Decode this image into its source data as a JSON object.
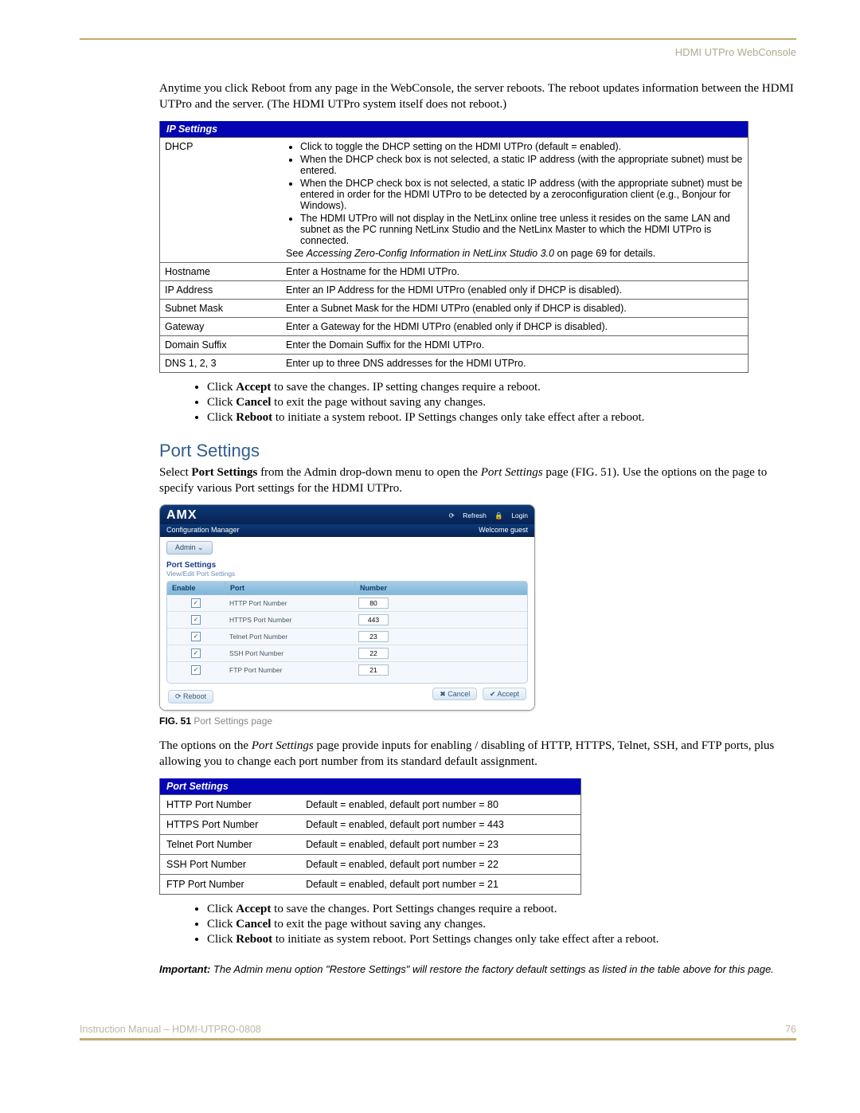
{
  "header": {
    "section_title": "HDMI UTPro WebConsole"
  },
  "intro": {
    "para": "Anytime you click Reboot from any page in the WebConsole, the server reboots. The reboot updates information between the HDMI UTPro and the server. (The HDMI UTPro system itself does not reboot.)"
  },
  "ip_settings": {
    "header": "IP Settings",
    "rows": [
      {
        "label": "DHCP",
        "bullets": [
          "Click to toggle the DHCP setting on the HDMI UTPro (default = enabled).",
          "When the DHCP check box is not selected, a static IP address (with the appropriate subnet) must be entered.",
          "When the DHCP check box is not selected, a static IP address (with the appropriate subnet) must be entered in order for the HDMI UTPro to be detected by a zeroconfiguration client (e.g., Bonjour for Windows).",
          "The HDMI UTPro will not display in the NetLinx online tree unless it resides on the same LAN and subnet as the PC running NetLinx Studio and the NetLinx Master to which the HDMI UTPro is connected."
        ],
        "see_prefix": "See ",
        "see_italic": "Accessing Zero-Config Information in NetLinx Studio 3.0",
        "see_suffix": " on page 69 for details."
      },
      {
        "label": "Hostname",
        "desc": "Enter a Hostname for the HDMI UTPro."
      },
      {
        "label": "IP Address",
        "desc": "Enter an IP Address for the HDMI UTPro (enabled only if DHCP is disabled)."
      },
      {
        "label": "Subnet Mask",
        "desc": "Enter a Subnet Mask for the HDMI UTPro (enabled only if DHCP is disabled)."
      },
      {
        "label": "Gateway",
        "desc": "Enter a Gateway for the HDMI UTPro (enabled only if DHCP is disabled)."
      },
      {
        "label": "Domain Suffix",
        "desc": "Enter the Domain Suffix for the HDMI UTPro."
      },
      {
        "label": "DNS 1, 2, 3",
        "desc": "Enter up to three DNS addresses for the HDMI UTPro."
      }
    ]
  },
  "actions_ip": {
    "accept": "Click Accept to save the changes. IP setting changes require a reboot.",
    "cancel": "Click Cancel to exit the page without saving any changes.",
    "reboot": "Click Reboot to initiate a system reboot. IP Settings changes only take effect after a reboot."
  },
  "port_section": {
    "title": "Port Settings",
    "intro_html": "Select Port Settings from the Admin drop-down menu to open the Port Settings page (FIG. 51). Use the options on the page to specify various Port settings for the HDMI UTPro."
  },
  "figure": {
    "logo": "AMX",
    "config_label": "Configuration Manager",
    "refresh": "Refresh",
    "login": "Login",
    "welcome": "Welcome guest",
    "admin_btn": "Admin ⌄",
    "title": "Port Settings",
    "subtitle": "View/Edit Port Settings",
    "col_enable": "Enable",
    "col_port": "Port",
    "col_number": "Number",
    "rows": [
      {
        "label": "HTTP Port Number",
        "value": "80"
      },
      {
        "label": "HTTPS Port Number",
        "value": "443"
      },
      {
        "label": "Telnet Port Number",
        "value": "23"
      },
      {
        "label": "SSH Port Number",
        "value": "22"
      },
      {
        "label": "FTP Port Number",
        "value": "21"
      }
    ],
    "reboot_btn": "Reboot",
    "cancel_btn": "Cancel",
    "accept_btn": "Accept",
    "caption_strong": "FIG. 51",
    "caption_rest": "  Port Settings page"
  },
  "after_fig_para": "The options on the Port Settings page provide inputs for enabling / disabling of HTTP, HTTPS, Telnet, SSH, and FTP ports, plus allowing you to change each port number from its standard default assignment.",
  "port_table": {
    "header": "Port Settings",
    "rows": [
      {
        "label": "HTTP Port Number",
        "desc": "Default = enabled, default port number = 80"
      },
      {
        "label": "HTTPS Port Number",
        "desc": "Default = enabled, default port number = 443"
      },
      {
        "label": "Telnet Port Number",
        "desc": "Default = enabled, default port number = 23"
      },
      {
        "label": "SSH Port Number",
        "desc": "Default = enabled, default port number = 22"
      },
      {
        "label": "FTP Port Number",
        "desc": "Default = enabled, default port number = 21"
      }
    ]
  },
  "actions_port": {
    "accept": "Click Accept to save the changes. Port Settings changes require a reboot.",
    "cancel": "Click Cancel to exit the page without saving any changes.",
    "reboot": "Click Reboot to initiate as system reboot. Port Settings changes only take effect after a reboot."
  },
  "important": {
    "lead": "Important:",
    "rest": " The Admin menu option \"Restore Settings\" will restore the factory default settings as listed in the table above for this page."
  },
  "footer": {
    "left": "Instruction Manual – HDMI-UTPRO-0808",
    "right": "76"
  }
}
